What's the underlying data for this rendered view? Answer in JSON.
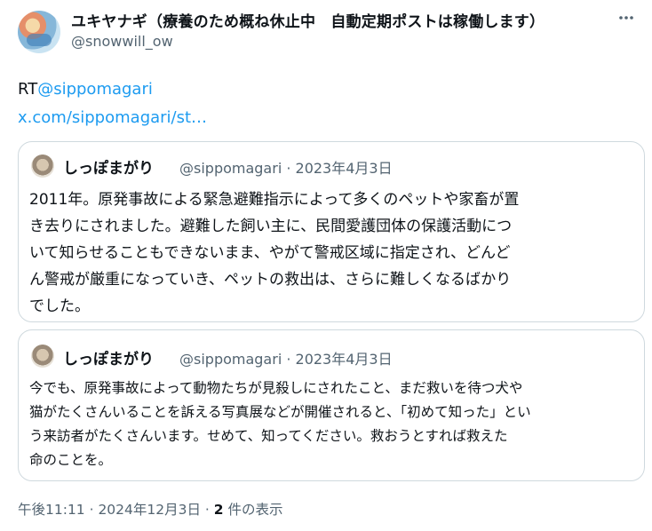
{
  "tweet": {
    "display_name": "ユキヤナギ（療養のため概ね休止中　自動定期ポストは稼働します）",
    "handle": "@snowwill_ow",
    "text_prefix": "RT",
    "mention": "@sippomagari",
    "link": "x.com/sippomagari/st…",
    "timestamp": "午後11:11 · 2024年12月3日 · ",
    "views_count": "2",
    "views_label": " 件の表示"
  },
  "quote1": {
    "name": "しっぽまがり",
    "meta": "@sippomagari · 2023年4月3日",
    "lines": [
      "2011年。原発事故による緊急避難指示によって多くのペットや家畜が置",
      "き去りにされました。避難した飼い主に、民間愛護団体の保護活動につ",
      "いて知らせることもできないまま、やがて警戒区域に指定され、どんど",
      "ん警戒が厳重になっていき、ペットの救出は、さらに難しくなるばかり",
      "でした。"
    ]
  },
  "quote2": {
    "name": "しっぽまがり",
    "meta": "@sippomagari · 2023年4月3日",
    "lines": [
      "今でも、原発事故によって動物たちが見殺しにされたこと、まだ救いを待つ犬や",
      "猫がたくさんいることを訴える写真展などが開催されると、「初めて知った」とい",
      "う来訪者がたくさんいます。せめて、知ってください。救おうとすれば救えた",
      "命のことを。"
    ]
  },
  "icons": {
    "more": "more-icon",
    "avatar": "avatar"
  },
  "colors": {
    "link": "#1d9bf0",
    "secondary_text": "#536471",
    "border": "#cfd9de"
  }
}
